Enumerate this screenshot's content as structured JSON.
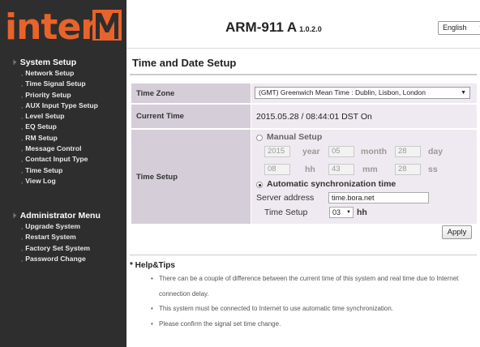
{
  "brand": {
    "logo_text": "interM"
  },
  "sidebar": {
    "groups": [
      {
        "title": "System Setup",
        "items": [
          {
            "label": "Network Setup"
          },
          {
            "label": "Time Signal Setup"
          },
          {
            "label": "Priority Setup"
          },
          {
            "label": "AUX Input Type Setup"
          },
          {
            "label": "Level Setup"
          },
          {
            "label": "EQ Setup"
          },
          {
            "label": "RM Setup"
          },
          {
            "label": "Message Control"
          },
          {
            "label": "Contact Input Type"
          },
          {
            "label": "Time Setup"
          },
          {
            "label": "View Log"
          }
        ]
      },
      {
        "title": "Administrator Menu",
        "items": [
          {
            "label": "Upgrade System"
          },
          {
            "label": "Restart System"
          },
          {
            "label": "Factory Set System"
          },
          {
            "label": "Password Change"
          }
        ]
      }
    ]
  },
  "header": {
    "product": "ARM-911 A",
    "version": "1.0.2.0",
    "language": "English"
  },
  "page": {
    "title": "Time and Date Setup",
    "time_zone": {
      "label": "Time Zone",
      "value": "(GMT) Greenwich Mean Time : Dublin, Lisbon, London"
    },
    "current_time": {
      "label": "Current Time",
      "value": "2015.05.28 / 08:44:01 DST On"
    },
    "time_setup": {
      "label": "Time Setup",
      "manual": {
        "label": "Manual Setup",
        "selected": false,
        "year": "2015",
        "year_unit": "year",
        "month": "05",
        "month_unit": "month",
        "day": "28",
        "day_unit": "day",
        "hour": "08",
        "hour_unit": "hh",
        "minute": "43",
        "minute_unit": "mm",
        "second": "28",
        "second_unit": "ss"
      },
      "auto": {
        "label": "Automatic synchronization time",
        "selected": true,
        "server_label": "Server address",
        "server_value": "time.bora.net",
        "interval_label": "Time Setup",
        "interval_value": "03",
        "interval_unit": "hh"
      }
    },
    "apply_label": "Apply"
  },
  "help": {
    "title": "* Help&Tips",
    "tips": [
      "There can be a couple of difference between the current time of this system and real time due to Internet connection delay.",
      "This system must be connected to Internet to use automatic time synchronization.",
      "Please confirm the signal set time change."
    ]
  },
  "colors": {
    "sidebar_bg": "#2e2e2e",
    "logo_orange": "#e8632a",
    "label_cell_bg": "#d5ced8",
    "value_cell_bg": "#efeaf1"
  }
}
